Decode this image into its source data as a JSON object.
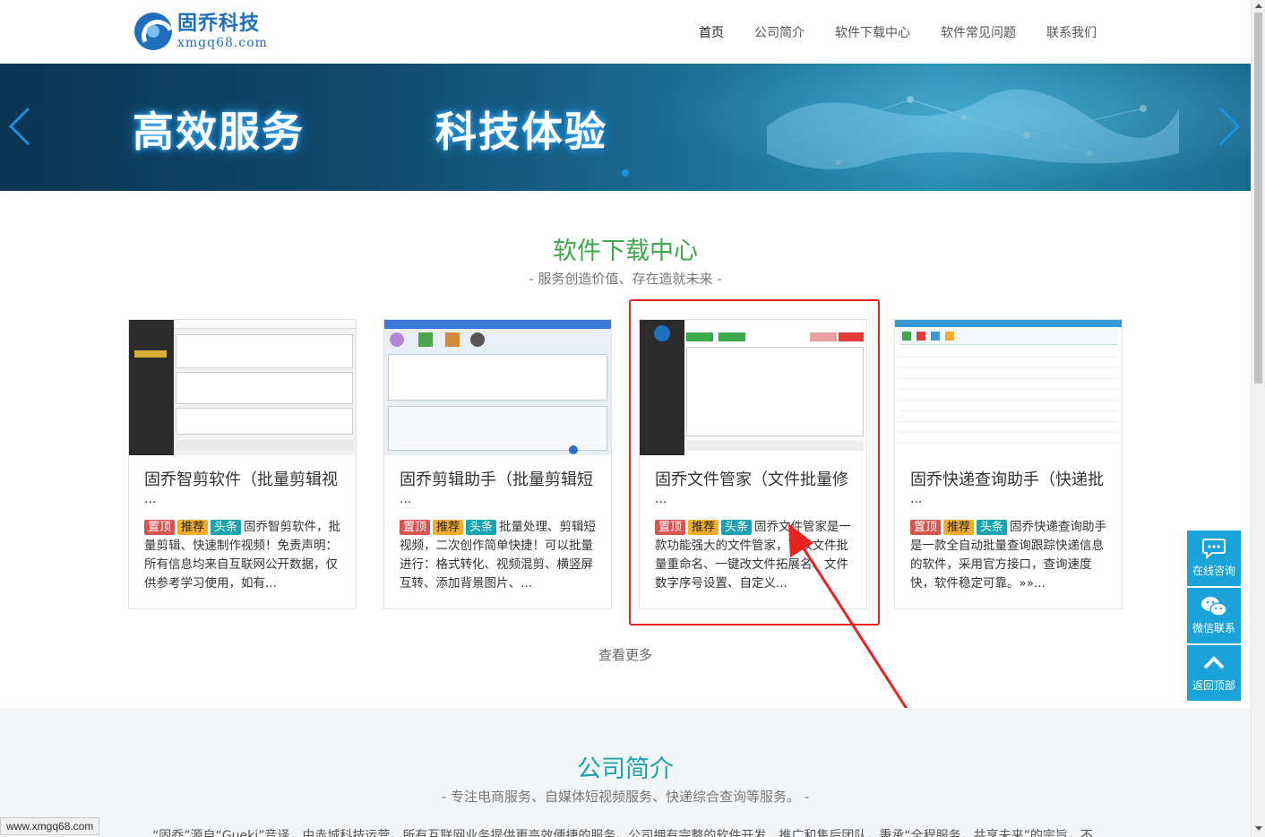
{
  "header": {
    "logo_cn": "固乔科技",
    "logo_en": "xmgq68.com",
    "nav": [
      "首页",
      "公司简介",
      "软件下载中心",
      "软件常见问题",
      "联系我们"
    ],
    "active_nav": "首页"
  },
  "banner": {
    "text_left": "高效服务",
    "text_right": "科技体验",
    "slide_indicator": "1"
  },
  "download_section": {
    "title": "软件下载中心",
    "subtitle": "- 服务创造价值、存在造就未来 -",
    "tags": [
      "置顶",
      "推荐",
      "头条"
    ],
    "ellipsis": "...",
    "cards": [
      {
        "title": "固乔智剪软件（批量剪辑视",
        "desc": "固乔智剪软件，批量剪辑、快速制作视频！免责声明：所有信息均来自互联网公开数据，仅供参考学习使用，如有..."
      },
      {
        "title": "固乔剪辑助手（批量剪辑短",
        "desc": "批量处理、剪辑短视频，二次创作简单快捷！可以批量进行：格式转化、视频混剪、横竖屏互转、添加背景图片、..."
      },
      {
        "title": "固乔文件管家（文件批量修",
        "desc": "固乔文件管家是一款功能强大的文件管家，可以文件批量重命名、一键改文件拓展名、文件数字序号设置、自定义..."
      },
      {
        "title": "固乔快递查询助手（快递批",
        "desc": "固乔快递查询助手是一款全自动批量查询跟踪快递信息的软件，采用官方接口，查询速度快，软件稳定可靠。»»..."
      }
    ],
    "more": "查看更多"
  },
  "company_section": {
    "title": "公司简介",
    "subtitle": "- 专注电商服务、自媒体短视频服务、快递综合查询等服务。 -",
    "partial_text": "“固乔”源自“Gueki”音译，由赤城科技运营，所有互联网业务提供更高效便捷的服务。公司拥有完整的软件开发、推广和售后团队，秉承“全程服务，共享未来”的宗旨，不"
  },
  "side_float": [
    {
      "label": "在线咨询",
      "icon": "chat-icon"
    },
    {
      "label": "微信联系",
      "icon": "wechat-icon"
    },
    {
      "label": "返回顶部",
      "icon": "arrow-up-icon"
    }
  ],
  "status_bar": {
    "url": "www.xmgq68.com"
  },
  "colors": {
    "green_title": "#3aaa4a",
    "teal_title": "#1aa3b0",
    "highlight": "#e8221f",
    "float_bg": "#1aa3d8"
  }
}
